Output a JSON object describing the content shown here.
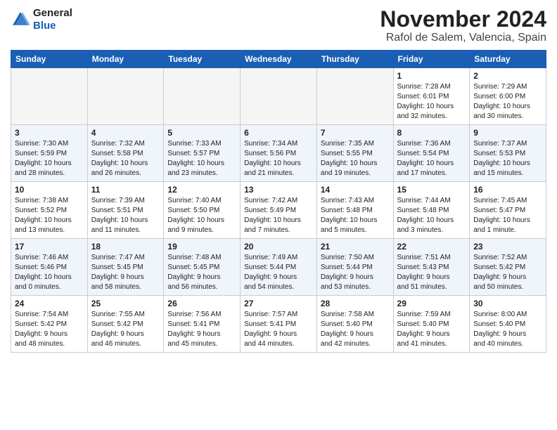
{
  "header": {
    "logo_line1": "General",
    "logo_line2": "Blue",
    "month": "November 2024",
    "location": "Rafol de Salem, Valencia, Spain"
  },
  "weekdays": [
    "Sunday",
    "Monday",
    "Tuesday",
    "Wednesday",
    "Thursday",
    "Friday",
    "Saturday"
  ],
  "weeks": [
    [
      {
        "day": "",
        "info": ""
      },
      {
        "day": "",
        "info": ""
      },
      {
        "day": "",
        "info": ""
      },
      {
        "day": "",
        "info": ""
      },
      {
        "day": "",
        "info": ""
      },
      {
        "day": "1",
        "info": "Sunrise: 7:28 AM\nSunset: 6:01 PM\nDaylight: 10 hours\nand 32 minutes."
      },
      {
        "day": "2",
        "info": "Sunrise: 7:29 AM\nSunset: 6:00 PM\nDaylight: 10 hours\nand 30 minutes."
      }
    ],
    [
      {
        "day": "3",
        "info": "Sunrise: 7:30 AM\nSunset: 5:59 PM\nDaylight: 10 hours\nand 28 minutes."
      },
      {
        "day": "4",
        "info": "Sunrise: 7:32 AM\nSunset: 5:58 PM\nDaylight: 10 hours\nand 26 minutes."
      },
      {
        "day": "5",
        "info": "Sunrise: 7:33 AM\nSunset: 5:57 PM\nDaylight: 10 hours\nand 23 minutes."
      },
      {
        "day": "6",
        "info": "Sunrise: 7:34 AM\nSunset: 5:56 PM\nDaylight: 10 hours\nand 21 minutes."
      },
      {
        "day": "7",
        "info": "Sunrise: 7:35 AM\nSunset: 5:55 PM\nDaylight: 10 hours\nand 19 minutes."
      },
      {
        "day": "8",
        "info": "Sunrise: 7:36 AM\nSunset: 5:54 PM\nDaylight: 10 hours\nand 17 minutes."
      },
      {
        "day": "9",
        "info": "Sunrise: 7:37 AM\nSunset: 5:53 PM\nDaylight: 10 hours\nand 15 minutes."
      }
    ],
    [
      {
        "day": "10",
        "info": "Sunrise: 7:38 AM\nSunset: 5:52 PM\nDaylight: 10 hours\nand 13 minutes."
      },
      {
        "day": "11",
        "info": "Sunrise: 7:39 AM\nSunset: 5:51 PM\nDaylight: 10 hours\nand 11 minutes."
      },
      {
        "day": "12",
        "info": "Sunrise: 7:40 AM\nSunset: 5:50 PM\nDaylight: 10 hours\nand 9 minutes."
      },
      {
        "day": "13",
        "info": "Sunrise: 7:42 AM\nSunset: 5:49 PM\nDaylight: 10 hours\nand 7 minutes."
      },
      {
        "day": "14",
        "info": "Sunrise: 7:43 AM\nSunset: 5:48 PM\nDaylight: 10 hours\nand 5 minutes."
      },
      {
        "day": "15",
        "info": "Sunrise: 7:44 AM\nSunset: 5:48 PM\nDaylight: 10 hours\nand 3 minutes."
      },
      {
        "day": "16",
        "info": "Sunrise: 7:45 AM\nSunset: 5:47 PM\nDaylight: 10 hours\nand 1 minute."
      }
    ],
    [
      {
        "day": "17",
        "info": "Sunrise: 7:46 AM\nSunset: 5:46 PM\nDaylight: 10 hours\nand 0 minutes."
      },
      {
        "day": "18",
        "info": "Sunrise: 7:47 AM\nSunset: 5:45 PM\nDaylight: 9 hours\nand 58 minutes."
      },
      {
        "day": "19",
        "info": "Sunrise: 7:48 AM\nSunset: 5:45 PM\nDaylight: 9 hours\nand 56 minutes."
      },
      {
        "day": "20",
        "info": "Sunrise: 7:49 AM\nSunset: 5:44 PM\nDaylight: 9 hours\nand 54 minutes."
      },
      {
        "day": "21",
        "info": "Sunrise: 7:50 AM\nSunset: 5:44 PM\nDaylight: 9 hours\nand 53 minutes."
      },
      {
        "day": "22",
        "info": "Sunrise: 7:51 AM\nSunset: 5:43 PM\nDaylight: 9 hours\nand 51 minutes."
      },
      {
        "day": "23",
        "info": "Sunrise: 7:52 AM\nSunset: 5:42 PM\nDaylight: 9 hours\nand 50 minutes."
      }
    ],
    [
      {
        "day": "24",
        "info": "Sunrise: 7:54 AM\nSunset: 5:42 PM\nDaylight: 9 hours\nand 48 minutes."
      },
      {
        "day": "25",
        "info": "Sunrise: 7:55 AM\nSunset: 5:42 PM\nDaylight: 9 hours\nand 46 minutes."
      },
      {
        "day": "26",
        "info": "Sunrise: 7:56 AM\nSunset: 5:41 PM\nDaylight: 9 hours\nand 45 minutes."
      },
      {
        "day": "27",
        "info": "Sunrise: 7:57 AM\nSunset: 5:41 PM\nDaylight: 9 hours\nand 44 minutes."
      },
      {
        "day": "28",
        "info": "Sunrise: 7:58 AM\nSunset: 5:40 PM\nDaylight: 9 hours\nand 42 minutes."
      },
      {
        "day": "29",
        "info": "Sunrise: 7:59 AM\nSunset: 5:40 PM\nDaylight: 9 hours\nand 41 minutes."
      },
      {
        "day": "30",
        "info": "Sunrise: 8:00 AM\nSunset: 5:40 PM\nDaylight: 9 hours\nand 40 minutes."
      }
    ]
  ]
}
